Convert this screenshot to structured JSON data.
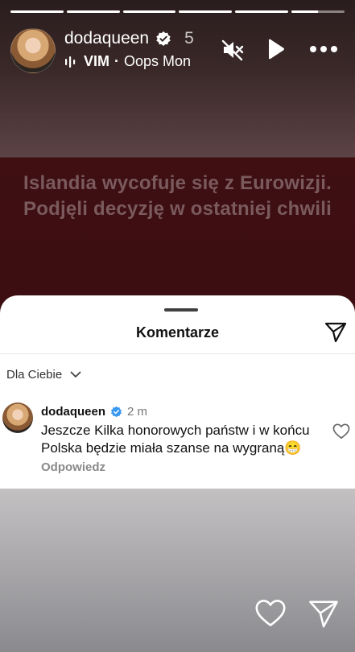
{
  "story": {
    "progress_segments": [
      1,
      1,
      1,
      1,
      1,
      0.5
    ],
    "username": "dodaqueen",
    "time": "5",
    "music": {
      "artist": "VIM",
      "song": "Oops Mon"
    },
    "headline": "Islandia wycofuje się z Eurowizji. Podjęli decyzję w ostatniej chwili"
  },
  "comments_sheet": {
    "title": "Komentarze",
    "filter_label": "Dla Ciebie",
    "comments": [
      {
        "username": "dodaqueen",
        "time": "2 m",
        "text": "Jeszcze Kilka honorowych państw i w końcu Polska będzie miała szanse na wygraną😁",
        "reply_label": "Odpowiedz"
      }
    ]
  },
  "colors": {
    "verified": "#3897f0",
    "story_red": "#3c0e11"
  }
}
